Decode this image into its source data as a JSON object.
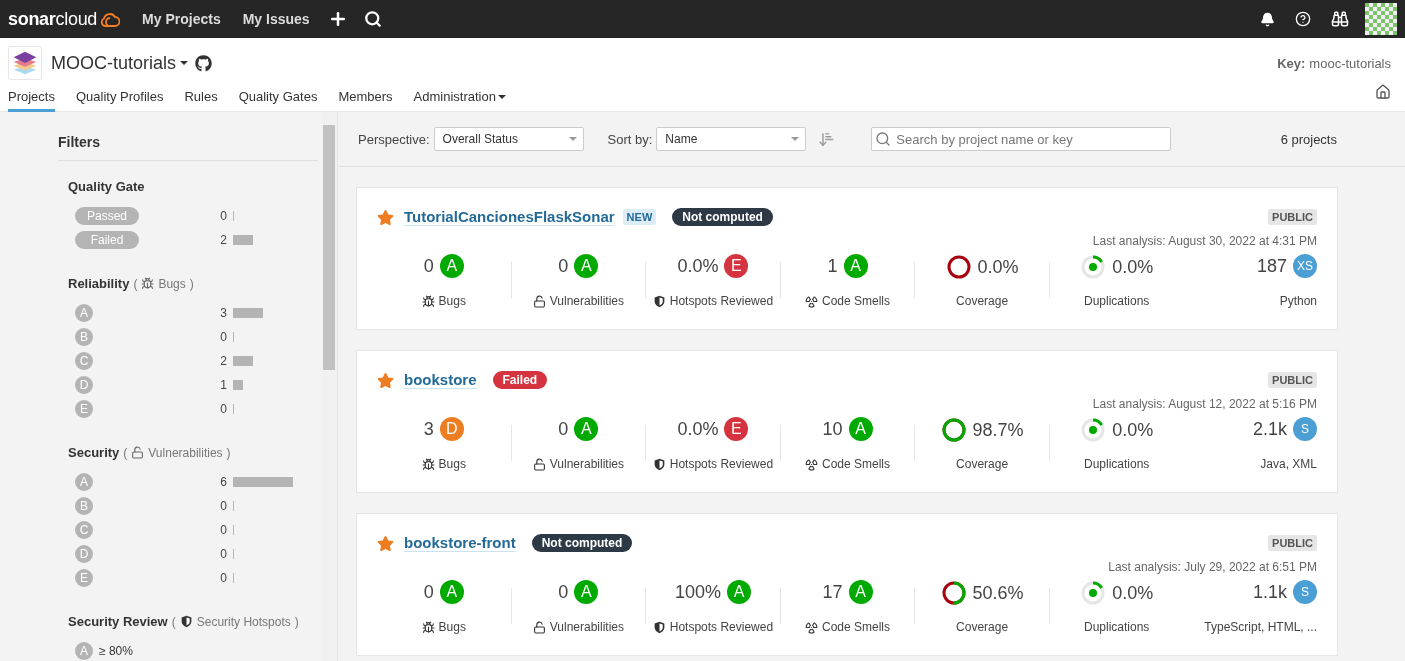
{
  "topbar": {
    "logo": "**sonar**cloud",
    "links": [
      {
        "label": "My Projects"
      },
      {
        "label": "My Issues"
      }
    ]
  },
  "org": {
    "name": "MOOC-tutorials",
    "key_label": "Key:",
    "key": "mooc-tutorials"
  },
  "tabs": [
    {
      "label": "Projects",
      "selected": true,
      "dropdown": false
    },
    {
      "label": "Quality Profiles",
      "selected": false,
      "dropdown": false
    },
    {
      "label": "Rules",
      "selected": false,
      "dropdown": false
    },
    {
      "label": "Quality Gates",
      "selected": false,
      "dropdown": false
    },
    {
      "label": "Members",
      "selected": false,
      "dropdown": false
    },
    {
      "label": "Administration",
      "selected": false,
      "dropdown": true
    }
  ],
  "filters": {
    "title": "Filters",
    "sections": [
      {
        "kind": "gate",
        "title": "Quality Gate",
        "items": [
          {
            "kind": "pill",
            "label": "Passed",
            "count": "0"
          },
          {
            "kind": "pill",
            "label": "Failed",
            "count": "2"
          }
        ]
      },
      {
        "kind": "reliability",
        "title": "Reliability",
        "open": "(",
        "subtitle": "Bugs",
        "close": ")",
        "items": [
          {
            "kind": "rating",
            "label": "A",
            "count": "3"
          },
          {
            "kind": "rating",
            "label": "B",
            "count": "0"
          },
          {
            "kind": "rating",
            "label": "C",
            "count": "2"
          },
          {
            "kind": "rating",
            "label": "D",
            "count": "1"
          },
          {
            "kind": "rating",
            "label": "E",
            "count": "0"
          }
        ]
      },
      {
        "kind": "security",
        "title": "Security",
        "open": "(",
        "subtitle": "Vulnerabilities",
        "close": ")",
        "items": [
          {
            "kind": "rating",
            "label": "A",
            "count": "6"
          },
          {
            "kind": "rating",
            "label": "B",
            "count": "0"
          },
          {
            "kind": "rating",
            "label": "C",
            "count": "0"
          },
          {
            "kind": "rating",
            "label": "D",
            "count": "0"
          },
          {
            "kind": "rating",
            "label": "E",
            "count": "0"
          }
        ]
      },
      {
        "kind": "review",
        "title": "Security Review",
        "open": "(",
        "subtitle": "Security Hotspots",
        "close": ")",
        "items": [
          {
            "kind": "threshold",
            "label": "A",
            "text": "≥ 80%"
          }
        ]
      }
    ]
  },
  "toolbar": {
    "perspective_label": "Perspective:",
    "perspective": "Overall Status",
    "sort_label": "Sort by:",
    "sort": "Name",
    "search": {
      "placeholder": "Search by project name or key"
    },
    "count": "6 projects"
  },
  "projects": [
    {
      "name": "TutorialCancionesFlaskSonar",
      "starred": true,
      "badge": "NEW",
      "gate": {
        "label": "Not computed",
        "color": "#2d3a46"
      },
      "visibility": "PUBLIC",
      "last_analysis": "Last analysis: August 30, 2022 at 4:31 PM",
      "metrics": [
        {
          "kind": "bugs",
          "value": "0",
          "rating": "A",
          "color": "#00aa00",
          "label": "Bugs"
        },
        {
          "kind": "vulnerabilities",
          "value": "0",
          "rating": "A",
          "color": "#00aa00",
          "label": "Vulnerabilities"
        },
        {
          "kind": "hotspots",
          "value": "0.0%",
          "rating": "E",
          "color": "#d4333f",
          "label": "Hotspots Reviewed"
        },
        {
          "kind": "smells",
          "value": "1",
          "rating": "A",
          "color": "#00aa00",
          "label": "Code Smells"
        },
        {
          "kind": "coverage",
          "value": "0.0%",
          "label": "Coverage"
        },
        {
          "kind": "duplications",
          "value": "0.0%",
          "label": "Duplications"
        },
        {
          "kind": "size",
          "value": "187",
          "rating": "XS",
          "label": "Python"
        }
      ]
    },
    {
      "name": "bookstore",
      "starred": true,
      "gate": {
        "label": "Failed",
        "color": "#d4333f"
      },
      "visibility": "PUBLIC",
      "last_analysis": "Last analysis: August 12, 2022 at 5:16 PM",
      "metrics": [
        {
          "kind": "bugs",
          "value": "3",
          "rating": "D",
          "color": "#ed7d20",
          "label": "Bugs"
        },
        {
          "kind": "vulnerabilities",
          "value": "0",
          "rating": "A",
          "color": "#00aa00",
          "label": "Vulnerabilities"
        },
        {
          "kind": "hotspots",
          "value": "0.0%",
          "rating": "E",
          "color": "#d4333f",
          "label": "Hotspots Reviewed"
        },
        {
          "kind": "smells",
          "value": "10",
          "rating": "A",
          "color": "#00aa00",
          "label": "Code Smells"
        },
        {
          "kind": "coverage",
          "value": "98.7%",
          "label": "Coverage"
        },
        {
          "kind": "duplications",
          "value": "0.0%",
          "label": "Duplications"
        },
        {
          "kind": "size",
          "value": "2.1k",
          "rating": "S",
          "label": "Java, XML"
        }
      ]
    },
    {
      "name": "bookstore-front",
      "starred": true,
      "gate": {
        "label": "Not computed",
        "color": "#2d3a46"
      },
      "visibility": "PUBLIC",
      "last_analysis": "Last analysis: July 29, 2022 at 6:51 PM",
      "metrics": [
        {
          "kind": "bugs",
          "value": "0",
          "rating": "A",
          "color": "#00aa00",
          "label": "Bugs"
        },
        {
          "kind": "vulnerabilities",
          "value": "0",
          "rating": "A",
          "color": "#00aa00",
          "label": "Vulnerabilities"
        },
        {
          "kind": "hotspots",
          "value": "100%",
          "rating": "A",
          "color": "#00aa00",
          "label": "Hotspots Reviewed"
        },
        {
          "kind": "smells",
          "value": "17",
          "rating": "A",
          "color": "#00aa00",
          "label": "Code Smells"
        },
        {
          "kind": "coverage",
          "value": "50.6%",
          "label": "Coverage"
        },
        {
          "kind": "duplications",
          "value": "0.0%",
          "label": "Duplications"
        },
        {
          "kind": "size",
          "value": "1.1k",
          "rating": "S",
          "label": "TypeScript, HTML, ..."
        }
      ]
    }
  ]
}
